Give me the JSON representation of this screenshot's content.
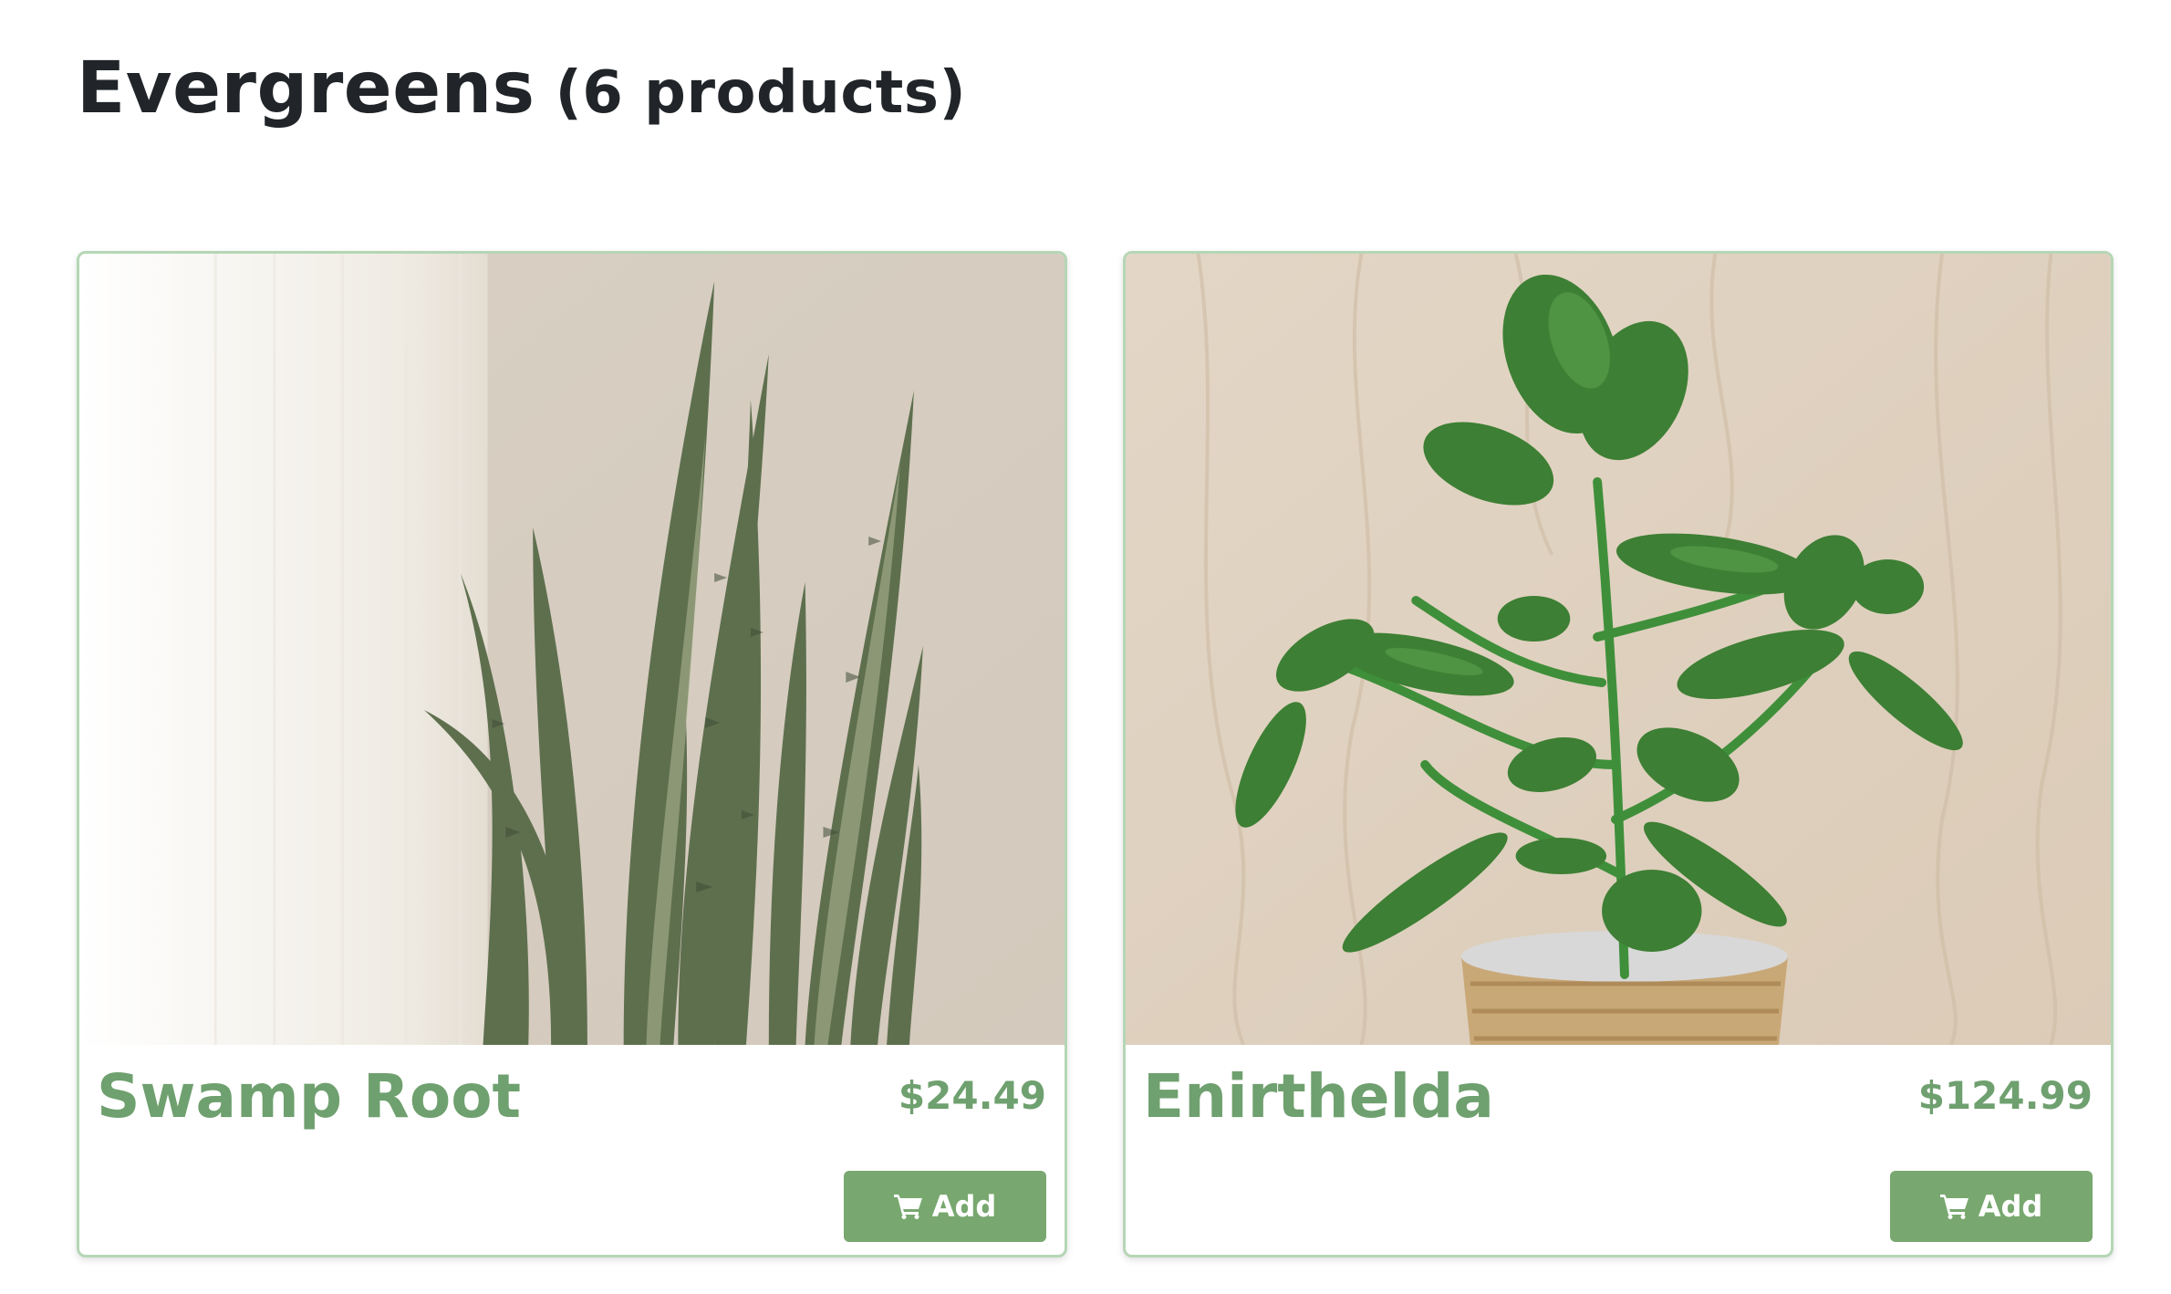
{
  "category": {
    "title": "Evergreens",
    "count_label": "(6 products)"
  },
  "products": [
    {
      "name": "Swamp Root",
      "price": "$24.49",
      "add_label": "Add",
      "add_icon": "cart-icon"
    },
    {
      "name": "Enirthelda",
      "price": "$124.99",
      "add_label": "Add",
      "add_icon": "cart-icon"
    }
  ],
  "colors": {
    "accent_green": "#6fa06f",
    "button_green": "#78a86f",
    "card_border": "#b5d6b5",
    "heading": "#212529"
  }
}
